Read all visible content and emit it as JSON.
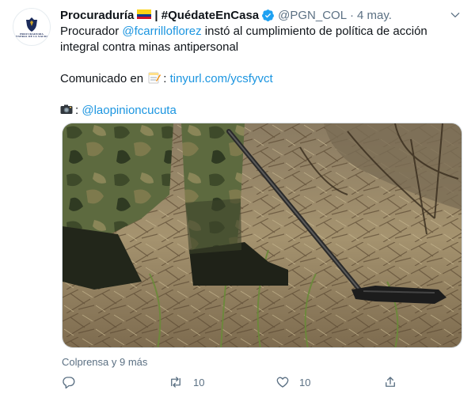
{
  "account": {
    "name": "Procuraduría",
    "hashtag": "| #QuédateEnCasa",
    "handle": "@PGN_COL",
    "separator": "·",
    "date": "4 may.",
    "avatar_text": "PROCURADURIA GENERAL DE LA NACION"
  },
  "tweet": {
    "line1_prefix": "Procurador ",
    "mention": "@fcarrilloflorez",
    "line1_suffix": " instó al cumplimiento de política de acción integral contra minas antipersonal",
    "comunicado_label": "Comunicado en",
    "comunicado_colon": ":",
    "link": "tinyurl.com/ycsfyvct",
    "photo_colon": ":",
    "photo_credit": "@laopinioncucuta"
  },
  "media_source": "Colprensa y 9 más",
  "actions": {
    "retweets": "10",
    "likes": "10"
  },
  "colors": {
    "link": "#1b95e0",
    "muted": "#5b7083",
    "verified": "#1da1f2"
  },
  "icons": [
    "flag-colombia-icon",
    "verified-badge-icon",
    "chevron-down-icon",
    "memo-icon",
    "camera-icon",
    "reply-icon",
    "retweet-icon",
    "like-icon",
    "share-icon"
  ]
}
